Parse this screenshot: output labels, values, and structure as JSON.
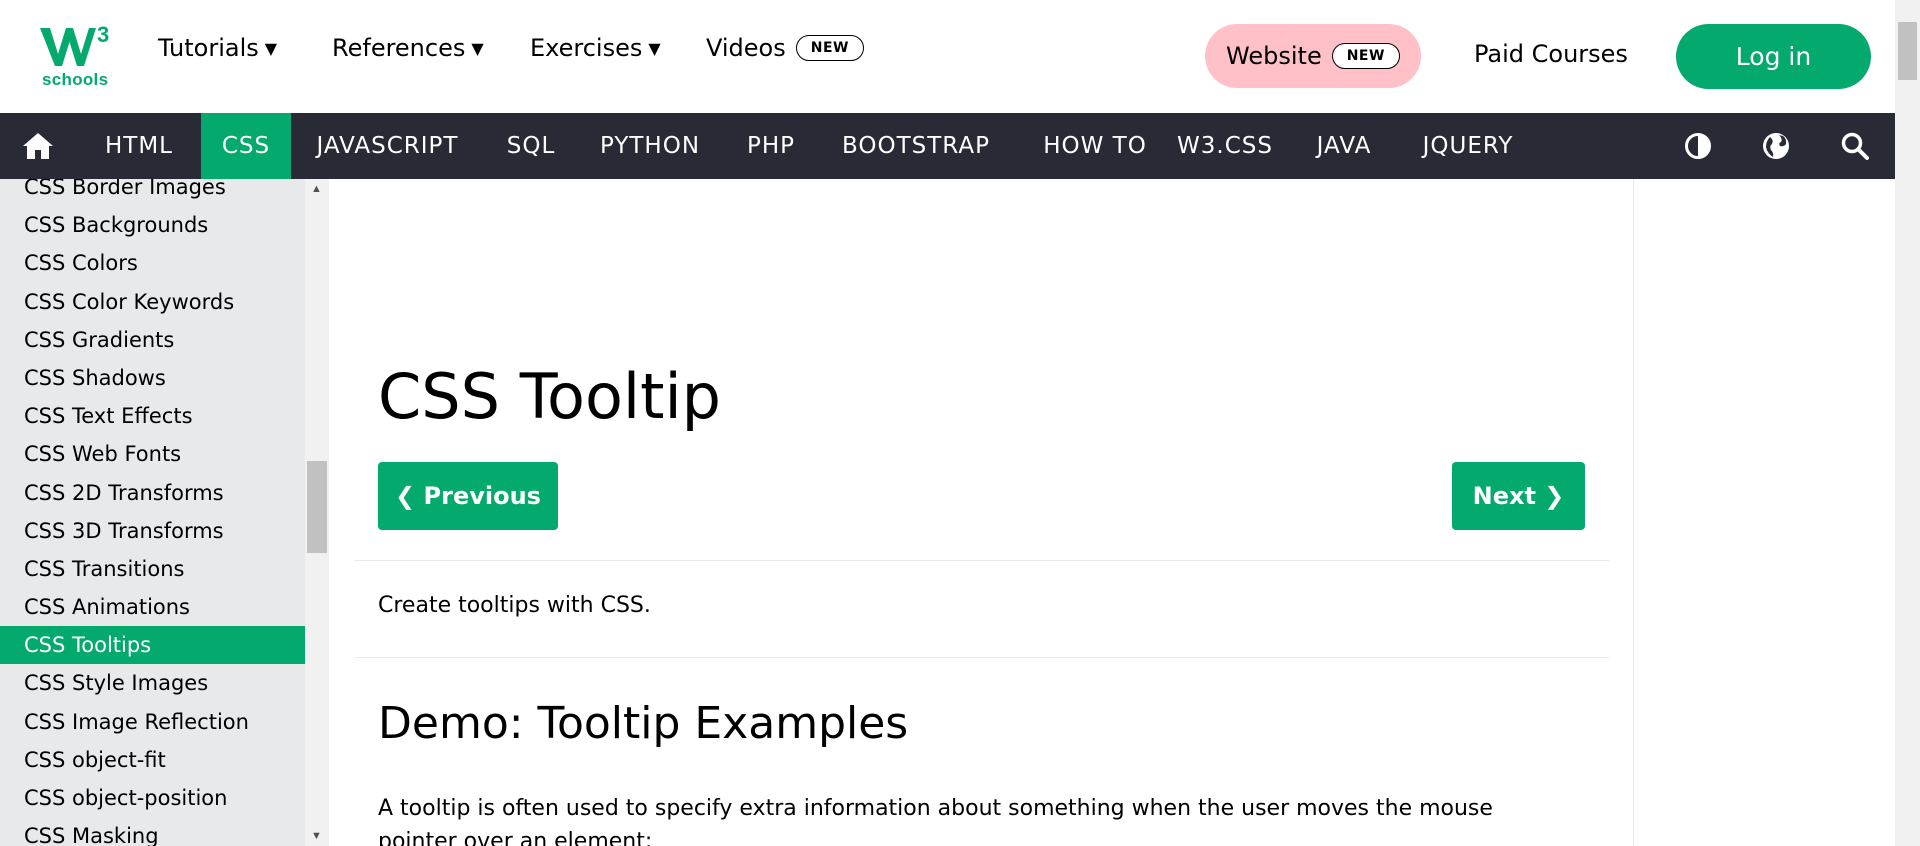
{
  "brand": {
    "logo_mark": "W3",
    "logo_sup": "3",
    "logo_sub": "schools",
    "accent": "#04AA6D",
    "nav_bg": "#282A35",
    "sidebar_bg": "#E7E9EB",
    "website_bg": "#FFC0C7"
  },
  "header": {
    "tutorials": "Tutorials",
    "references": "References",
    "exercises": "Exercises",
    "videos": "Videos",
    "videos_badge": "NEW",
    "website": "Website",
    "website_badge": "NEW",
    "paid_courses": "Paid Courses",
    "login": "Log in",
    "caret_icon": "caret-down-icon"
  },
  "nav": {
    "home_icon": "home-icon",
    "items": [
      "HTML",
      "CSS",
      "JAVASCRIPT",
      "SQL",
      "PYTHON",
      "PHP",
      "BOOTSTRAP",
      "HOW TO",
      "W3.CSS",
      "JAVA",
      "JQUERY"
    ],
    "active": "CSS",
    "right_icons": [
      "contrast-icon",
      "globe-icon",
      "search-icon"
    ]
  },
  "sidebar": {
    "items": [
      "CSS Border Images",
      "CSS Backgrounds",
      "CSS Colors",
      "CSS Color Keywords",
      "CSS Gradients",
      "CSS Shadows",
      "CSS Text Effects",
      "CSS Web Fonts",
      "CSS 2D Transforms",
      "CSS 3D Transforms",
      "CSS Transitions",
      "CSS Animations",
      "CSS Tooltips",
      "CSS Style Images",
      "CSS Image Reflection",
      "CSS object-fit",
      "CSS object-position",
      "CSS Masking"
    ],
    "active": "CSS Tooltips"
  },
  "main": {
    "title": "CSS Tooltip",
    "prev_label": "❮ Previous",
    "next_label": "Next ❯",
    "intro": "Create tooltips with CSS.",
    "section_title": "Demo: Tooltip Examples",
    "body_line1": "A tooltip is often used to specify extra information about something when the user moves the mouse",
    "body_line2": "pointer over an element:"
  }
}
